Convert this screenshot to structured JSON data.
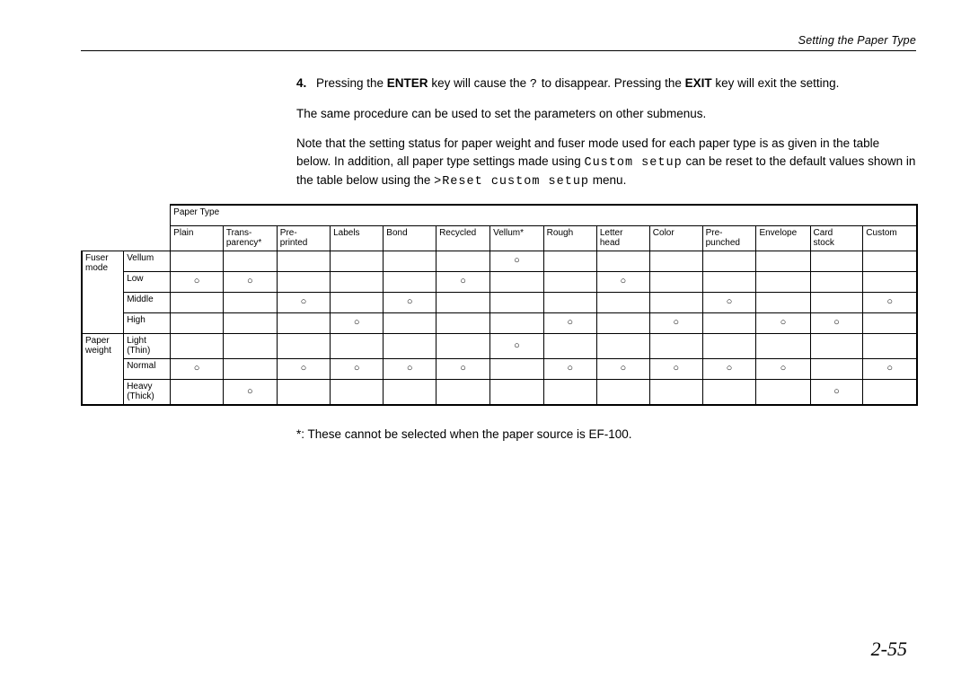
{
  "header": {
    "title": "Setting the Paper Type"
  },
  "step": {
    "num": "4.",
    "pressing_the": "Pressing the ",
    "enter": "ENTER",
    "will_cause": " key will cause the ",
    "glyph": "?",
    "to_disappear": " to disappear. Pressing the ",
    "exit": "EXIT",
    "will_exit": " key will exit the setting."
  },
  "p1": "The same procedure can be used to set the parameters on other submenus.",
  "p2a": "Note that the setting status for paper weight and fuser mode used for each paper type is as given in the table below. In addition, all paper type settings made using ",
  "mono1": "Custom setup",
  "p2b": " can be reset to the default values shown in the table below using the ",
  "mono2": ">Reset custom setup",
  "p2c": " menu.",
  "table": {
    "header_title": "Paper Type",
    "columns": [
      "Plain",
      "Trans-parency*",
      "Pre-printed",
      "Labels",
      "Bond",
      "Recycled",
      "Vellum*",
      "Rough",
      "Letter head",
      "Color",
      "Pre-punched",
      "Envelope",
      "Card stock",
      "Custom"
    ],
    "fuser_label": "Fuser mode",
    "weight_label": "Paper weight",
    "rows": {
      "vellum": {
        "label": "Vellum",
        "marks": [
          "",
          "",
          "",
          "",
          "",
          "",
          "o",
          "",
          "",
          "",
          "",
          "",
          "",
          ""
        ]
      },
      "low": {
        "label": "Low",
        "marks": [
          "o",
          "o",
          "",
          "",
          "",
          "o",
          "",
          "",
          "o",
          "",
          "",
          "",
          "",
          ""
        ]
      },
      "middle": {
        "label": "Middle",
        "marks": [
          "",
          "",
          "o",
          "",
          "o",
          "",
          "",
          "",
          "",
          "",
          "o",
          "",
          "",
          "o"
        ]
      },
      "high": {
        "label": "High",
        "marks": [
          "",
          "",
          "",
          "o",
          "",
          "",
          "",
          "o",
          "",
          "o",
          "",
          "o",
          "o",
          ""
        ]
      },
      "light": {
        "label": "Light (Thin)",
        "marks": [
          "",
          "",
          "",
          "",
          "",
          "",
          "o",
          "",
          "",
          "",
          "",
          "",
          "",
          ""
        ]
      },
      "normal": {
        "label": "Normal",
        "marks": [
          "o",
          "",
          "o",
          "o",
          "o",
          "o",
          "",
          "o",
          "o",
          "o",
          "o",
          "o",
          "",
          "o"
        ]
      },
      "heavy": {
        "label": "Heavy (Thick)",
        "marks": [
          "",
          "o",
          "",
          "",
          "",
          "",
          "",
          "",
          "",
          "",
          "",
          "",
          "o",
          ""
        ]
      }
    }
  },
  "footnote": "*: These cannot be selected when the paper source is EF-100.",
  "page_number": "2-55",
  "mark_char": "○",
  "chart_data": {
    "type": "table",
    "title": "Paper Type default settings",
    "columns": [
      "Plain",
      "Transparency*",
      "Pre-printed",
      "Labels",
      "Bond",
      "Recycled",
      "Vellum*",
      "Rough",
      "Letter head",
      "Color",
      "Pre-punched",
      "Envelope",
      "Card stock",
      "Custom"
    ],
    "groups": [
      {
        "name": "Fuser mode",
        "rows": [
          {
            "name": "Vellum",
            "values": [
              0,
              0,
              0,
              0,
              0,
              0,
              1,
              0,
              0,
              0,
              0,
              0,
              0,
              0
            ]
          },
          {
            "name": "Low",
            "values": [
              1,
              1,
              0,
              0,
              0,
              1,
              0,
              0,
              1,
              0,
              0,
              0,
              0,
              0
            ]
          },
          {
            "name": "Middle",
            "values": [
              0,
              0,
              1,
              0,
              1,
              0,
              0,
              0,
              0,
              0,
              1,
              0,
              0,
              1
            ]
          },
          {
            "name": "High",
            "values": [
              0,
              0,
              0,
              1,
              0,
              0,
              0,
              1,
              0,
              1,
              0,
              1,
              1,
              0
            ]
          }
        ]
      },
      {
        "name": "Paper weight",
        "rows": [
          {
            "name": "Light (Thin)",
            "values": [
              0,
              0,
              0,
              0,
              0,
              0,
              1,
              0,
              0,
              0,
              0,
              0,
              0,
              0
            ]
          },
          {
            "name": "Normal",
            "values": [
              1,
              0,
              1,
              1,
              1,
              1,
              0,
              1,
              1,
              1,
              1,
              1,
              0,
              1
            ]
          },
          {
            "name": "Heavy (Thick)",
            "values": [
              0,
              1,
              0,
              0,
              0,
              0,
              0,
              0,
              0,
              0,
              0,
              0,
              1,
              0
            ]
          }
        ]
      }
    ]
  }
}
